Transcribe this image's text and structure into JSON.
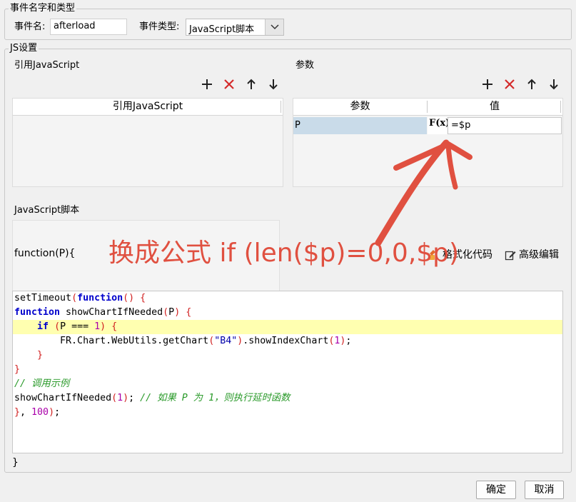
{
  "event_section": {
    "legend": "事件名字和类型",
    "name_label": "事件名:",
    "name_value": "afterload",
    "type_label": "事件类型:",
    "type_value": "JavaScript脚本"
  },
  "js_section": {
    "legend": "JS设置",
    "ref_js": {
      "title": "引用JavaScript",
      "column": "引用JavaScript"
    },
    "params": {
      "title": "参数",
      "col_param": "参数",
      "col_value": "值",
      "rows": [
        {
          "param": "P",
          "value": "=$p",
          "formula_icon": "F(x)"
        }
      ]
    },
    "script": {
      "title": "JavaScript脚本",
      "signature": "function(P){",
      "format_label": "格式化代码",
      "advanced_label": "高级编辑",
      "closing": "}",
      "code_lines": [
        "setTimeout(function() {",
        "function showChartIfNeeded(P) {",
        "    if (P === 1) {",
        "        FR.Chart.WebUtils.getChart(\"B4\").showIndexChart(1);",
        "    }",
        "}",
        "// 调用示例",
        "showChartIfNeeded(1); // 如果 P 为 1，则执行延时函数",
        "}, 100);"
      ]
    }
  },
  "annotation": "换成公式 if (len($p)=0,0,$p)",
  "footer": {
    "ok_label": "确定",
    "cancel_label": "取消"
  },
  "icons": [
    "plus-icon",
    "delete-x-icon",
    "arrow-up-icon",
    "arrow-down-icon",
    "formula-icon",
    "format-code-icon",
    "edit-icon",
    "dropdown-chevron-icon"
  ],
  "colors": {
    "annotation": "#e05040",
    "highlight_line": "#ffffb0",
    "param_cell": "#c9dbe9"
  }
}
